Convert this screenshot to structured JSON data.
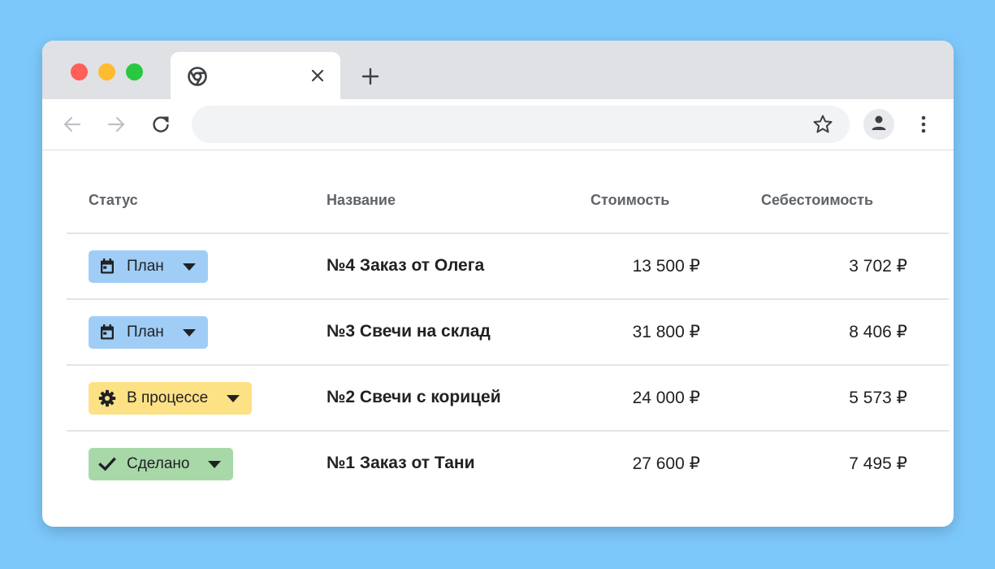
{
  "browser": {
    "tab": {
      "favicon_icon": "chrome-icon",
      "close_icon": "close-icon"
    },
    "new_tab_icon": "plus-icon",
    "nav": {
      "back_icon": "arrow-left-icon",
      "forward_icon": "arrow-right-icon",
      "reload_icon": "reload-icon"
    },
    "omnibox": {
      "value": "",
      "placeholder": ""
    },
    "bookmark_icon": "star-icon",
    "profile_icon": "person-icon",
    "menu_icon": "kebab-menu-icon"
  },
  "table": {
    "headers": {
      "status": "Статус",
      "name": "Название",
      "cost": "Стоимость",
      "self_cost": "Себестоимость"
    },
    "rows": [
      {
        "status": "План",
        "status_icon": "calendar-icon",
        "status_color": "#9fcdf6",
        "name": "№4 Заказ от Олега",
        "cost": "13 500 ₽",
        "self_cost": "3 702 ₽"
      },
      {
        "status": "План",
        "status_icon": "calendar-icon",
        "status_color": "#9fcdf6",
        "name": "№3 Свечи на склад",
        "cost": "31 800 ₽",
        "self_cost": "8 406 ₽"
      },
      {
        "status": "В процессе",
        "status_icon": "gear-icon",
        "status_color": "#fde185",
        "name": "№2 Свечи с корицей",
        "cost": "24 000 ₽",
        "self_cost": "5 573 ₽"
      },
      {
        "status": "Сделано",
        "status_icon": "checkmark-icon",
        "status_color": "#a8d8a8",
        "name": "№1 Заказ от Тани",
        "cost": "27 600 ₽",
        "self_cost": "7 495 ₽"
      }
    ]
  },
  "colors": {
    "background": "#7dc8fb",
    "tabbar": "#dfe1e5",
    "plan": "#9fcdf6",
    "in_progress": "#fde185",
    "done": "#a8d8a8"
  }
}
